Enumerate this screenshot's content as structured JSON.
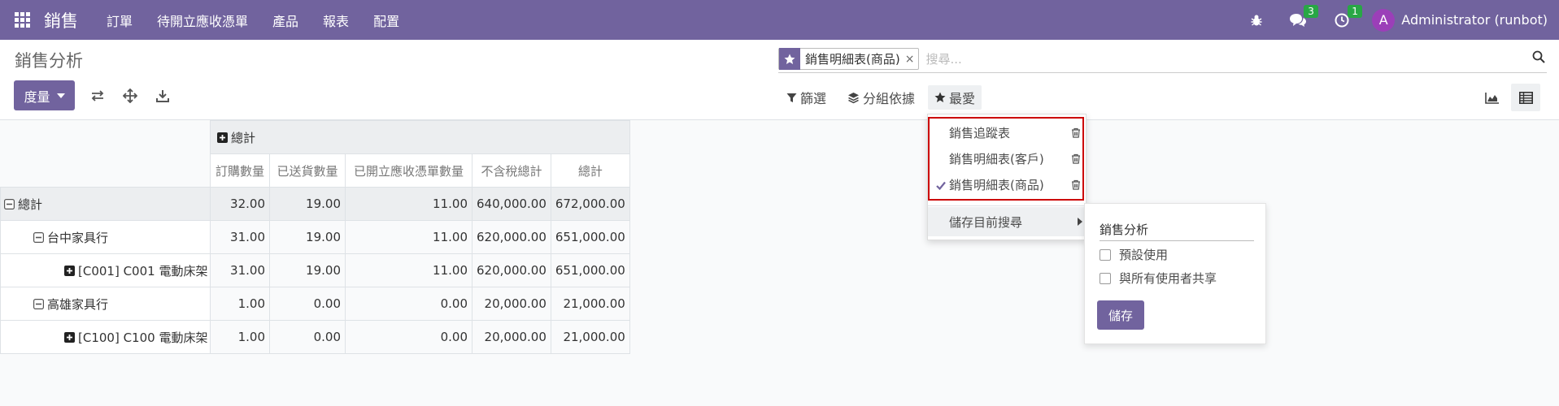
{
  "navbar": {
    "brand": "銷售",
    "menu": [
      "訂單",
      "待開立應收憑單",
      "產品",
      "報表",
      "配置"
    ],
    "messages_count": "3",
    "activities_count": "1",
    "avatar_initial": "A",
    "user": "Administrator (runbot)",
    "bg_color": "#71639e"
  },
  "control": {
    "title": "銷售分析",
    "measures_label": "度量",
    "search": {
      "facet_value": "銷售明細表(商品)",
      "facet_remove": "×",
      "placeholder": "搜尋..."
    },
    "filters_label": "篩選",
    "groupby_label": "分組依據",
    "favorites_label": "最愛"
  },
  "pivot": {
    "col_total": "總計",
    "measures": [
      "訂購數量",
      "已送貨數量",
      "已開立應收憑單數量",
      "不含稅總計",
      "總計"
    ],
    "rows": [
      {
        "label": "總計",
        "values": [
          "32.00",
          "19.00",
          "11.00",
          "640,000.00",
          "672,000.00"
        ]
      },
      {
        "label": "台中家具行",
        "values": [
          "31.00",
          "19.00",
          "11.00",
          "620,000.00",
          "651,000.00"
        ]
      },
      {
        "label": "[C001] C001 電動床架",
        "values": [
          "31.00",
          "19.00",
          "11.00",
          "620,000.00",
          "651,000.00"
        ]
      },
      {
        "label": "高雄家具行",
        "values": [
          "1.00",
          "0.00",
          "0.00",
          "20,000.00",
          "21,000.00"
        ]
      },
      {
        "label": "[C100] C100 電動床架",
        "values": [
          "1.00",
          "0.00",
          "0.00",
          "20,000.00",
          "21,000.00"
        ]
      }
    ]
  },
  "favorites_menu": {
    "items": [
      {
        "label": "銷售追蹤表",
        "checked": false
      },
      {
        "label": "銷售明細表(客戶)",
        "checked": false
      },
      {
        "label": "銷售明細表(商品)",
        "checked": true
      }
    ],
    "save_current": "儲存目前搜尋"
  },
  "save_panel": {
    "name_value": "銷售分析",
    "default_label": "預設使用",
    "share_label": "與所有使用者共享",
    "save_label": "儲存"
  }
}
